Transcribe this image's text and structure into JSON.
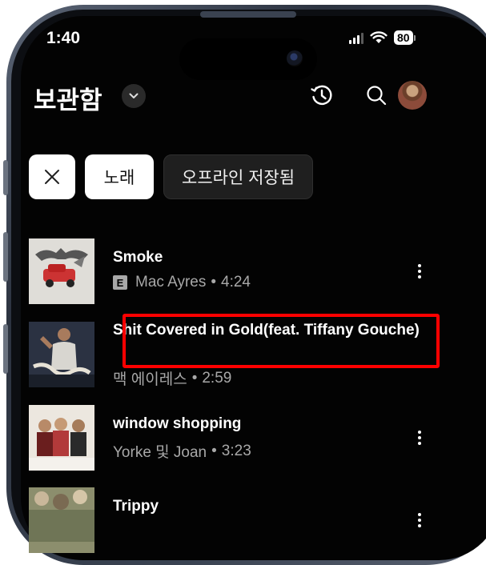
{
  "status_bar": {
    "time": "1:40",
    "battery": "80"
  },
  "header": {
    "title": "보관함",
    "icons": [
      "chevron-down-icon",
      "history-icon",
      "search-icon",
      "profile-avatar"
    ]
  },
  "chips": [
    {
      "label": "",
      "icon": "close-icon"
    },
    {
      "label": "노래"
    },
    {
      "label": "오프라인 저장됨"
    }
  ],
  "songs": [
    {
      "title": "Smoke",
      "explicit_badge": "E",
      "artist": "Mac Ayres",
      "separator": "•",
      "duration": "4:24"
    },
    {
      "title": "Shit Covered in Gold(feat. Tiffany Gouche)",
      "artist": "맥 에이레스",
      "separator": "•",
      "duration": "2:59"
    },
    {
      "title": "window shopping",
      "artist": "Yorke 및 Joan",
      "separator": "•",
      "duration": "3:23"
    },
    {
      "title": "Trippy"
    }
  ],
  "colors": {
    "background": "#030303",
    "highlight": "#ff0000",
    "chip_active": "#ffffff",
    "chip_inactive": "#1f1f1f"
  }
}
